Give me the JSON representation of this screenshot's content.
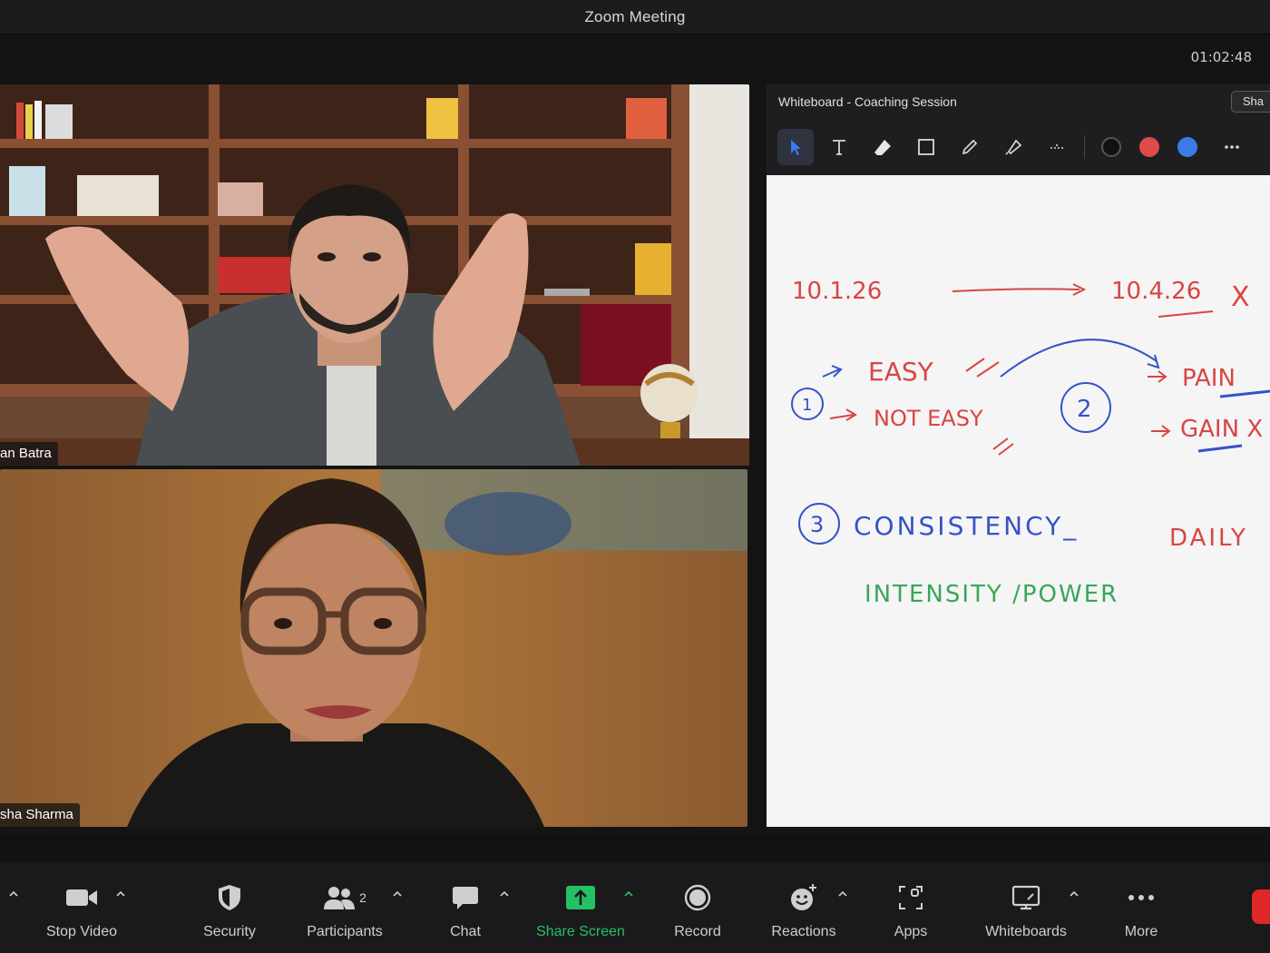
{
  "window": {
    "title": "Zoom Meeting"
  },
  "meeting": {
    "timer": "01:02:48"
  },
  "participants": [
    {
      "name": "an Batra"
    },
    {
      "name": "sha Sharma"
    }
  ],
  "whiteboard": {
    "title": "Whiteboard - Coaching Session",
    "share_label": "Sha",
    "tools": [
      "cursor-icon",
      "text-icon",
      "eraser-icon",
      "rectangle-icon",
      "pen-icon",
      "highlighter-icon",
      "connector-icon"
    ],
    "colors": [
      "#111111",
      "#e04a4a",
      "#3a7be8"
    ],
    "notes": {
      "date_start": "10.1.26",
      "date_end": "10.4.26",
      "mark_x": "X",
      "num1": "1",
      "easy": "EASY",
      "not_easy": "NOT EASY",
      "num2": "2",
      "pain": "PAIN",
      "gain": "GAIN X",
      "num3": "3",
      "consistency": "CONSISTENCY_",
      "daily": "DAILY",
      "intensity": "INTENSITY /POWER"
    }
  },
  "toolbar": {
    "stop_video": "Stop Video",
    "security": "Security",
    "participants": "Participants",
    "participants_count": "2",
    "chat": "Chat",
    "share_screen": "Share Screen",
    "record": "Record",
    "reactions": "Reactions",
    "apps": "Apps",
    "whiteboards": "Whiteboards",
    "more": "More"
  },
  "colors": {
    "accent_green": "#25c062",
    "end_red": "#e02828",
    "ink_red": "#d84545",
    "ink_blue": "#3552c8",
    "ink_green": "#3aa55a"
  }
}
